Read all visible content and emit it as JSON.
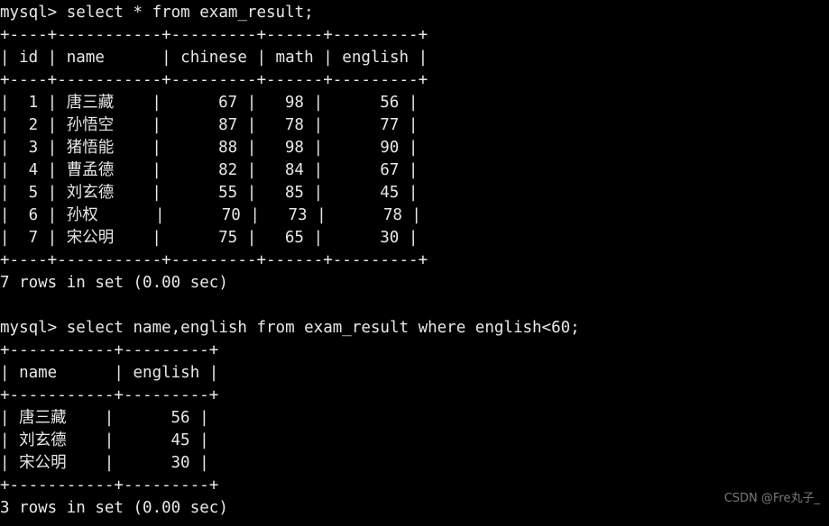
{
  "terminal": {
    "prompt": "mysql> ",
    "font_color": "#e8e8e8",
    "background_color": "#000000",
    "lines": [
      "mysql> select * from exam_result;",
      "+----+-----------+---------+------+---------+",
      "| id | name      | chinese | math | english |",
      "+----+-----------+---------+------+---------+",
      "|  1 | 唐三藏    |      67 |   98 |      56 |",
      "|  2 | 孙悟空    |      87 |   78 |      77 |",
      "|  3 | 猪悟能    |      88 |   98 |      90 |",
      "|  4 | 曹孟德    |      82 |   84 |      67 |",
      "|  5 | 刘玄德    |      55 |   85 |      45 |",
      "|  6 | 孙权      |      70 |   73 |      78 |",
      "|  7 | 宋公明    |      75 |   65 |      30 |",
      "+----+-----------+---------+------+---------+",
      "7 rows in set (0.00 sec)",
      "",
      "mysql> select name,english from exam_result where english<60;",
      "+-----------+---------+",
      "| name      | english |",
      "+-----------+---------+",
      "| 唐三藏    |      56 |",
      "| 刘玄德    |      45 |",
      "| 宋公明    |      30 |",
      "+-----------+---------+",
      "3 rows in set (0.00 sec)"
    ],
    "queries": [
      {
        "command": "select * from exam_result;",
        "columns": [
          "id",
          "name",
          "chinese",
          "math",
          "english"
        ],
        "rows": [
          [
            "1",
            "唐三藏",
            "67",
            "98",
            "56"
          ],
          [
            "2",
            "孙悟空",
            "87",
            "78",
            "77"
          ],
          [
            "3",
            "猪悟能",
            "88",
            "98",
            "90"
          ],
          [
            "4",
            "曹孟德",
            "82",
            "84",
            "67"
          ],
          [
            "5",
            "刘玄德",
            "55",
            "85",
            "45"
          ],
          [
            "6",
            "孙权",
            "70",
            "73",
            "78"
          ],
          [
            "7",
            "宋公明",
            "75",
            "65",
            "30"
          ]
        ],
        "result_status": "7 rows in set (0.00 sec)"
      },
      {
        "command": "select name,english from exam_result where english<60;",
        "columns": [
          "name",
          "english"
        ],
        "rows": [
          [
            "唐三藏",
            "56"
          ],
          [
            "刘玄德",
            "45"
          ],
          [
            "宋公明",
            "30"
          ]
        ],
        "result_status": "3 rows in set (0.00 sec)"
      }
    ]
  },
  "watermark": {
    "text": "CSDN @Fre丸子_"
  }
}
